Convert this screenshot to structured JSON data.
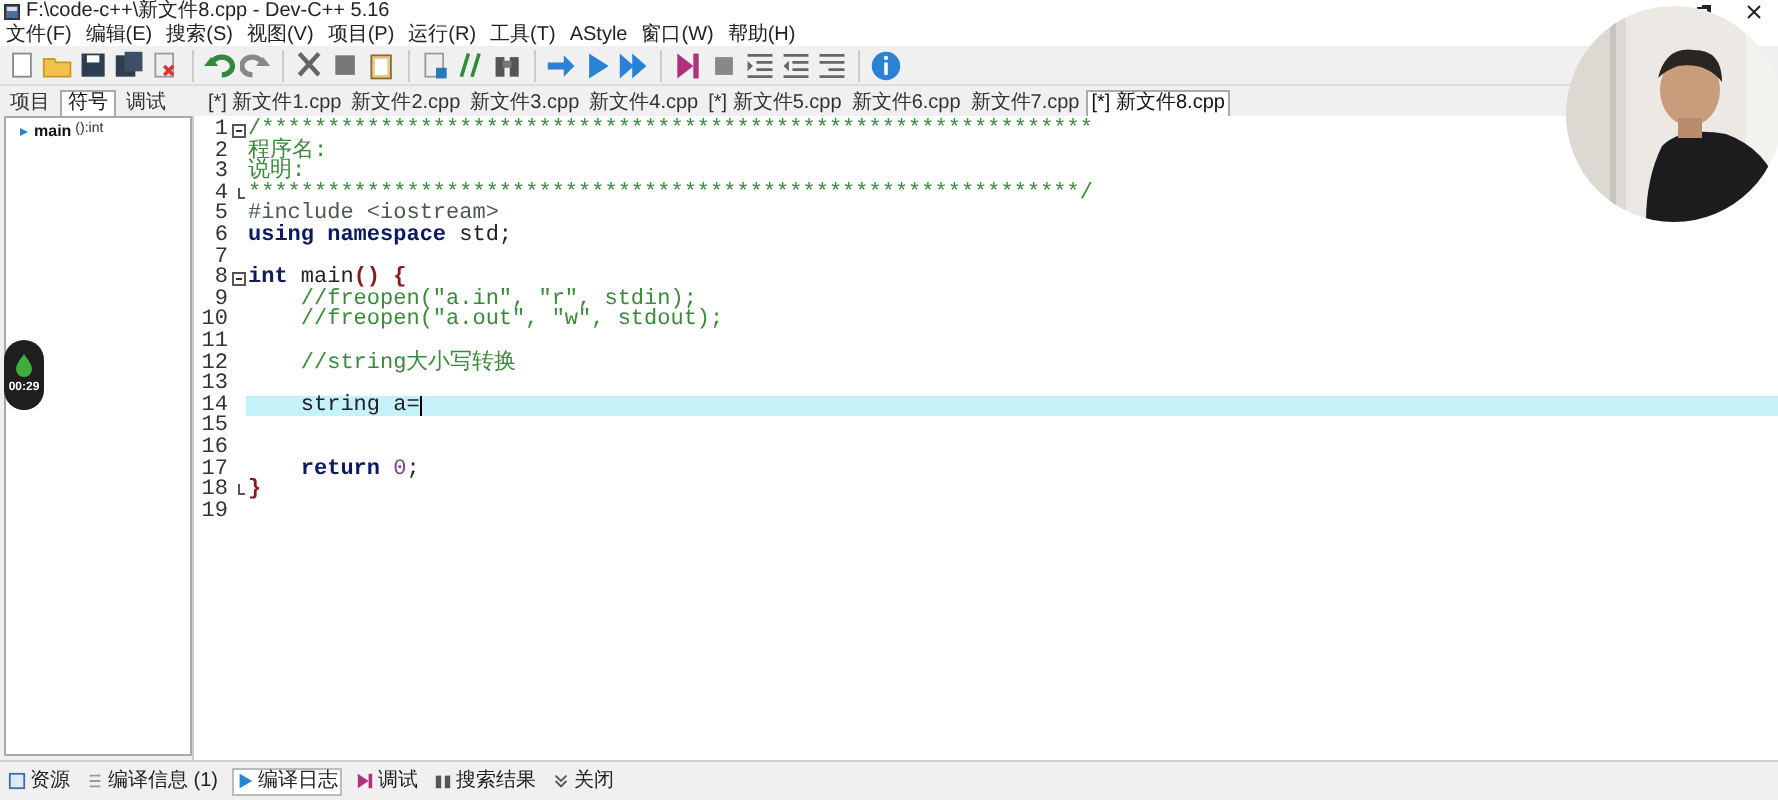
{
  "window": {
    "title": "F:\\code-c++\\新文件8.cpp - Dev-C++ 5.16"
  },
  "menu": [
    "文件(F)",
    "编辑(E)",
    "搜索(S)",
    "视图(V)",
    "项目(P)",
    "运行(R)",
    "工具(T)",
    "AStyle",
    "窗口(W)",
    "帮助(H)"
  ],
  "side_tabs": [
    {
      "label": "项目",
      "selected": false
    },
    {
      "label": "符号",
      "selected": true
    },
    {
      "label": "调试",
      "selected": false
    }
  ],
  "symbols": [
    {
      "name": "main",
      "type": "():int"
    }
  ],
  "file_tabs": [
    {
      "label": "[*] 新文件1.cpp",
      "selected": false
    },
    {
      "label": "新文件2.cpp",
      "selected": false
    },
    {
      "label": "新文件3.cpp",
      "selected": false
    },
    {
      "label": "新文件4.cpp",
      "selected": false
    },
    {
      "label": "[*] 新文件5.cpp",
      "selected": false
    },
    {
      "label": "新文件6.cpp",
      "selected": false
    },
    {
      "label": "新文件7.cpp",
      "selected": false
    },
    {
      "label": "[*] 新文件8.cpp",
      "selected": true
    }
  ],
  "code": [
    {
      "number": "1",
      "fold_start": true,
      "fold_end": false,
      "current": false,
      "tokens": [
        {
          "kind": "comment",
          "text": "/***************************************************************"
        }
      ]
    },
    {
      "number": "2",
      "fold_start": false,
      "fold_end": false,
      "current": false,
      "tokens": [
        {
          "kind": "comment",
          "text": "程序名:"
        }
      ]
    },
    {
      "number": "3",
      "fold_start": false,
      "fold_end": false,
      "current": false,
      "tokens": [
        {
          "kind": "comment",
          "text": "说明:"
        }
      ]
    },
    {
      "number": "4",
      "fold_start": false,
      "fold_end": true,
      "current": false,
      "tokens": [
        {
          "kind": "comment",
          "text": "***************************************************************/"
        }
      ]
    },
    {
      "number": "5",
      "fold_start": false,
      "fold_end": false,
      "current": false,
      "tokens": [
        {
          "kind": "preproc",
          "text": "#include <iostream>"
        }
      ]
    },
    {
      "number": "6",
      "fold_start": false,
      "fold_end": false,
      "current": false,
      "tokens": [
        {
          "kind": "keyword",
          "text": "using namespace"
        },
        {
          "kind": "plain",
          "text": " std;"
        }
      ]
    },
    {
      "number": "7",
      "fold_start": false,
      "fold_end": false,
      "current": false
    },
    {
      "number": "8",
      "fold_start": true,
      "fold_end": false,
      "current": false,
      "tokens": [
        {
          "kind": "keyword",
          "text": "int"
        },
        {
          "kind": "plain",
          "text": " main"
        },
        {
          "kind": "symbol",
          "text": "() {"
        }
      ]
    },
    {
      "number": "9",
      "fold_start": false,
      "fold_end": false,
      "current": false,
      "tokens": [
        {
          "kind": "comment",
          "text": "    //freopen(\"a.in\", \"r\", stdin);"
        }
      ]
    },
    {
      "number": "10",
      "fold_start": false,
      "fold_end": false,
      "current": false,
      "tokens": [
        {
          "kind": "comment",
          "text": "    //freopen(\"a.out\", \"w\", stdout);"
        }
      ]
    },
    {
      "number": "11",
      "fold_start": false,
      "fold_end": false,
      "current": false
    },
    {
      "number": "12",
      "fold_start": false,
      "fold_end": false,
      "current": false,
      "tokens": [
        {
          "kind": "comment",
          "text": "    //string大小写转换"
        }
      ]
    },
    {
      "number": "13",
      "fold_start": false,
      "fold_end": false,
      "current": false
    },
    {
      "number": "14",
      "fold_start": false,
      "fold_end": false,
      "current": true,
      "tokens": [
        {
          "kind": "plain",
          "text": "    string a="
        }
      ]
    },
    {
      "number": "15",
      "fold_start": false,
      "fold_end": false,
      "current": false
    },
    {
      "number": "16",
      "fold_start": false,
      "fold_end": false,
      "current": false
    },
    {
      "number": "17",
      "fold_start": false,
      "fold_end": false,
      "current": false,
      "tokens": [
        {
          "kind": "keyword",
          "text": "    return "
        },
        {
          "kind": "number",
          "text": "0"
        },
        {
          "kind": "plain",
          "text": ";"
        }
      ]
    },
    {
      "number": "18",
      "fold_start": false,
      "fold_end": true,
      "current": false,
      "tokens": [
        {
          "kind": "symbol",
          "text": "}"
        }
      ]
    },
    {
      "number": "19",
      "fold_start": false,
      "fold_end": false,
      "current": false
    }
  ],
  "bottom_tabs": [
    {
      "label": "资源",
      "selected": false
    },
    {
      "label": "编译信息 (1)",
      "selected": false
    },
    {
      "label": "编译日志",
      "selected": true
    },
    {
      "label": "调试",
      "selected": false
    },
    {
      "label": "搜索结果",
      "selected": false
    },
    {
      "label": "关闭",
      "selected": false
    }
  ],
  "recording": {
    "time": "00:29"
  }
}
